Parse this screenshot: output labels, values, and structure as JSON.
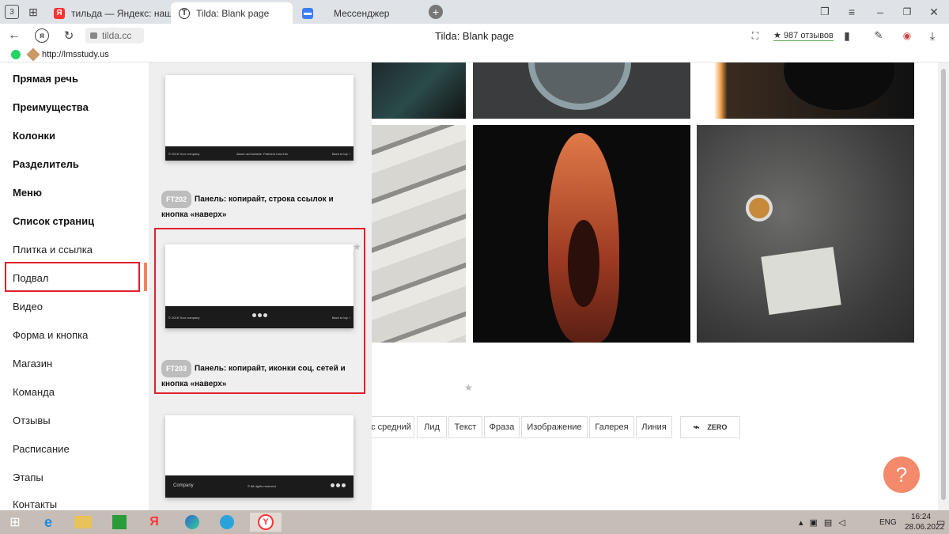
{
  "tabs": [
    {
      "label": "тильда — Яндекс: нашлос"
    },
    {
      "label": "Tilda: Blank page"
    },
    {
      "label": "Мессенджер"
    }
  ],
  "address": {
    "url": "tilda.cc",
    "title": "Tilda: Blank page",
    "reviews": "★ 987 отзывов"
  },
  "bookmarks": {
    "item": "http://lmsstudy.us"
  },
  "sidebar": {
    "items": [
      {
        "label": "Прямая речь"
      },
      {
        "label": "Преимущества"
      },
      {
        "label": "Колонки"
      },
      {
        "label": "Разделитель"
      },
      {
        "label": "Меню"
      },
      {
        "label": "Список страниц"
      },
      {
        "label": "Плитка и ссылка"
      },
      {
        "label": "Подвал"
      },
      {
        "label": "Видео"
      },
      {
        "label": "Форма и кнопка"
      },
      {
        "label": "Магазин"
      },
      {
        "label": "Команда"
      },
      {
        "label": "Отзывы"
      },
      {
        "label": "Расписание"
      },
      {
        "label": "Этапы"
      },
      {
        "label": "Контакты"
      }
    ]
  },
  "blocks": [
    {
      "code": "FT202",
      "desc": "Панель: копирайт, строка ссылок и кнопка «наверх»",
      "bar_left": "© 2016 Your company",
      "bar_links": [
        "About us",
        "Contacts",
        "Partners",
        "Law info"
      ],
      "bar_right": "Back to top ↑"
    },
    {
      "code": "FT203",
      "desc": "Панель: копирайт, иконки соц. сетей и кнопка «наверх»",
      "bar_left": "© 2016 Your company",
      "bar_right": "Back to top ↑"
    },
    {
      "bar_left": "Company",
      "bar_mid": "© All rights reserved"
    }
  ],
  "categories": [
    {
      "label": "с средний"
    },
    {
      "label": "Лид"
    },
    {
      "label": "Текст"
    },
    {
      "label": "Фраза"
    },
    {
      "label": "Изображение"
    },
    {
      "label": "Галерея"
    },
    {
      "label": "Линия"
    }
  ],
  "zero": {
    "label": "ZERO"
  },
  "help": {
    "label": "?"
  },
  "taskbar": {
    "time": "16:24",
    "date": "28.06.2022",
    "lang": "ENG"
  },
  "colors": {
    "accent": "#f4845f",
    "highlight": "#e0202c",
    "help": "#f4896b"
  }
}
